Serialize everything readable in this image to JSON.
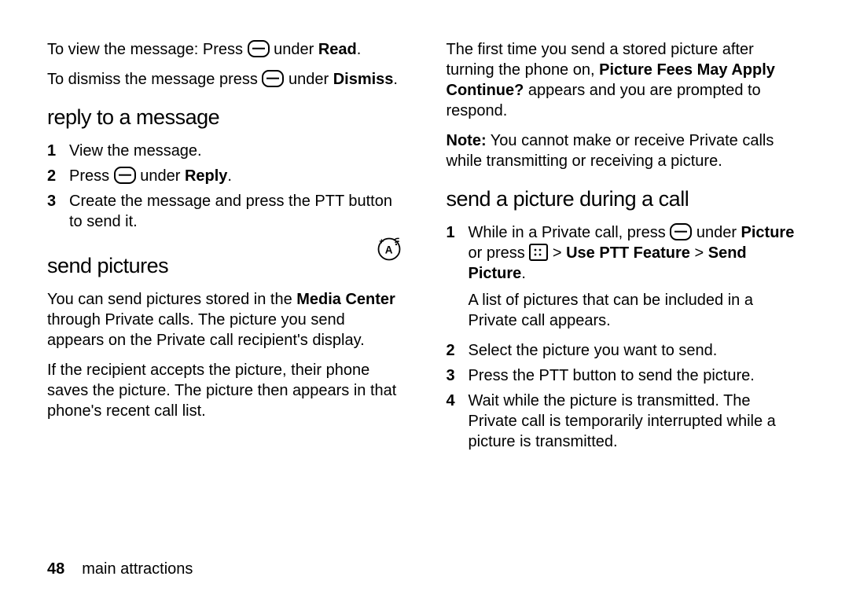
{
  "page_number": "48",
  "footer_text": "main attractions",
  "left": {
    "p1_a": "To view the message: Press ",
    "p1_b": " under ",
    "p1_c": "Read",
    "p1_d": ".",
    "p2_a": "To dismiss the message press ",
    "p2_b": " under ",
    "p2_c": "Dismiss",
    "p2_d": ".",
    "h_reply": "reply to a message",
    "reply_steps": {
      "s1": "View the message.",
      "s2_a": "Press ",
      "s2_b": " under ",
      "s2_c": "Reply",
      "s2_d": ".",
      "s3": "Create the message and press the PTT button to send it."
    },
    "h_send": "send pictures",
    "sp_p1_a": "You can send pictures stored in the ",
    "sp_p1_b": "Media Center",
    "sp_p1_c": " through Private calls. The picture you send appears on the Private call recipient's display.",
    "sp_p2": "If the recipient accepts the picture, their phone saves the picture. The picture then appears in that phone's recent call list."
  },
  "right": {
    "p1_a": "The first time you send a stored picture after turning the phone on, ",
    "p1_b": "Picture Fees May Apply Continue?",
    "p1_c": " appears and you are prompted to respond.",
    "note_label": "Note:",
    "note_text": " You cannot make or receive Private calls while transmitting or receiving a picture.",
    "h_sendcall": "send a picture during a call",
    "steps": {
      "s1_a": "While in a Private call, press ",
      "s1_b": " under ",
      "s1_c": "Picture",
      "s1_d": " or press ",
      "s1_e": " > ",
      "s1_f": "Use PTT Feature",
      "s1_g": " > ",
      "s1_h": "Send Picture",
      "s1_i": ".",
      "s1_p2": "A list of pictures that can be included in a Private call appears.",
      "s2": "Select the picture you want to send.",
      "s3": "Press the PTT button to send the picture.",
      "s4": "Wait while the picture is transmitted. The Private call is temporarily interrupted while a picture is transmitted."
    }
  }
}
